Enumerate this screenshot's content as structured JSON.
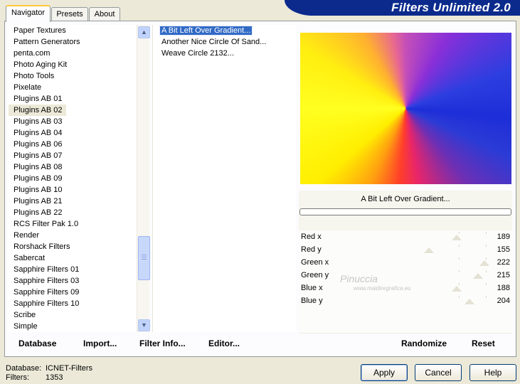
{
  "header": {
    "title": "Filters Unlimited 2.0"
  },
  "tabs": [
    {
      "label": "Navigator",
      "active": true
    },
    {
      "label": "Presets",
      "active": false
    },
    {
      "label": "About",
      "active": false
    }
  ],
  "categories": [
    "Paper Textures",
    "Pattern Generators",
    "penta.com",
    "Photo Aging Kit",
    "Photo Tools",
    "Pixelate",
    "Plugins AB 01",
    "Plugins AB 02",
    "Plugins AB 03",
    "Plugins AB 04",
    "Plugins AB 06",
    "Plugins AB 07",
    "Plugins AB 08",
    "Plugins AB 09",
    "Plugins AB 10",
    "Plugins AB 21",
    "Plugins AB 22",
    "RCS Filter Pak 1.0",
    "Render",
    "Rorshack Filters",
    "Sabercat",
    "Sapphire Filters 01",
    "Sapphire Filters 03",
    "Sapphire Filters 09",
    "Sapphire Filters 10",
    "Scribe",
    "Simple"
  ],
  "selected_category": "Plugins AB 02",
  "filters": [
    "A Bit Left Over Gradient...",
    "Another Nice Circle Of Sand...",
    "Weave Circle 2132..."
  ],
  "selected_filter": "A Bit Left Over Gradient...",
  "preview": {
    "name": "A Bit Left Over Gradient..."
  },
  "params": [
    {
      "label": "Red x",
      "value": "189",
      "fraction": 0.74
    },
    {
      "label": "Red y",
      "value": "155",
      "fraction": 0.61
    },
    {
      "label": "Green x",
      "value": "222",
      "fraction": 0.87
    },
    {
      "label": "Green y",
      "value": "215",
      "fraction": 0.84
    },
    {
      "label": "Blue x",
      "value": "188",
      "fraction": 0.74
    },
    {
      "label": "Blue y",
      "value": "204",
      "fraction": 0.8
    }
  ],
  "links": {
    "database": "Database",
    "import": "Import...",
    "filter_info": "Filter Info...",
    "editor": "Editor..."
  },
  "actions": {
    "randomize": "Randomize",
    "reset": "Reset"
  },
  "status": {
    "database_label": "Database:",
    "database_value": "ICNET-Filters",
    "filters_label": "Filters:",
    "filters_value": "1353"
  },
  "buttons": {
    "apply": "Apply",
    "cancel": "Cancel",
    "help": "Help"
  },
  "watermark": {
    "text": "Pinuccia",
    "sub": "www.maidiregrafica.eu"
  },
  "colors": {
    "banner": "#0b2a8c",
    "selection": "#316ac5",
    "panel": "#ece9d8"
  }
}
